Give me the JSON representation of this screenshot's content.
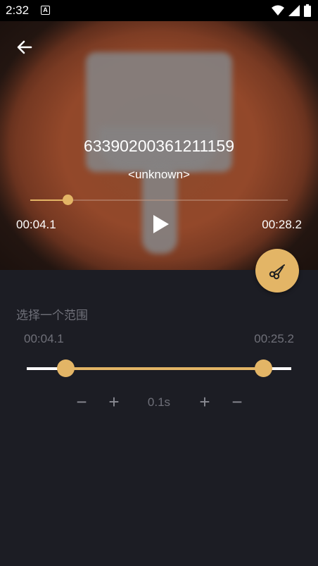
{
  "status_bar": {
    "time": "2:32",
    "notification_glyph": "A",
    "icons": [
      "wifi-icon",
      "signal-icon",
      "battery-icon"
    ]
  },
  "player": {
    "title": "63390200361211159",
    "subtitle": "<unknown>",
    "current_time": "00:04.1",
    "duration": "00:28.2",
    "progress_fraction": 0.146,
    "accent_color": "#e3b566"
  },
  "trim": {
    "label": "选择一个范围",
    "start_time": "00:04.1",
    "end_time": "00:25.2",
    "start_fraction": 0.146,
    "end_fraction": 0.894,
    "step_value": "0.1s",
    "start_decrease": "−",
    "start_increase": "+",
    "end_increase": "+",
    "end_decrease": "−"
  }
}
